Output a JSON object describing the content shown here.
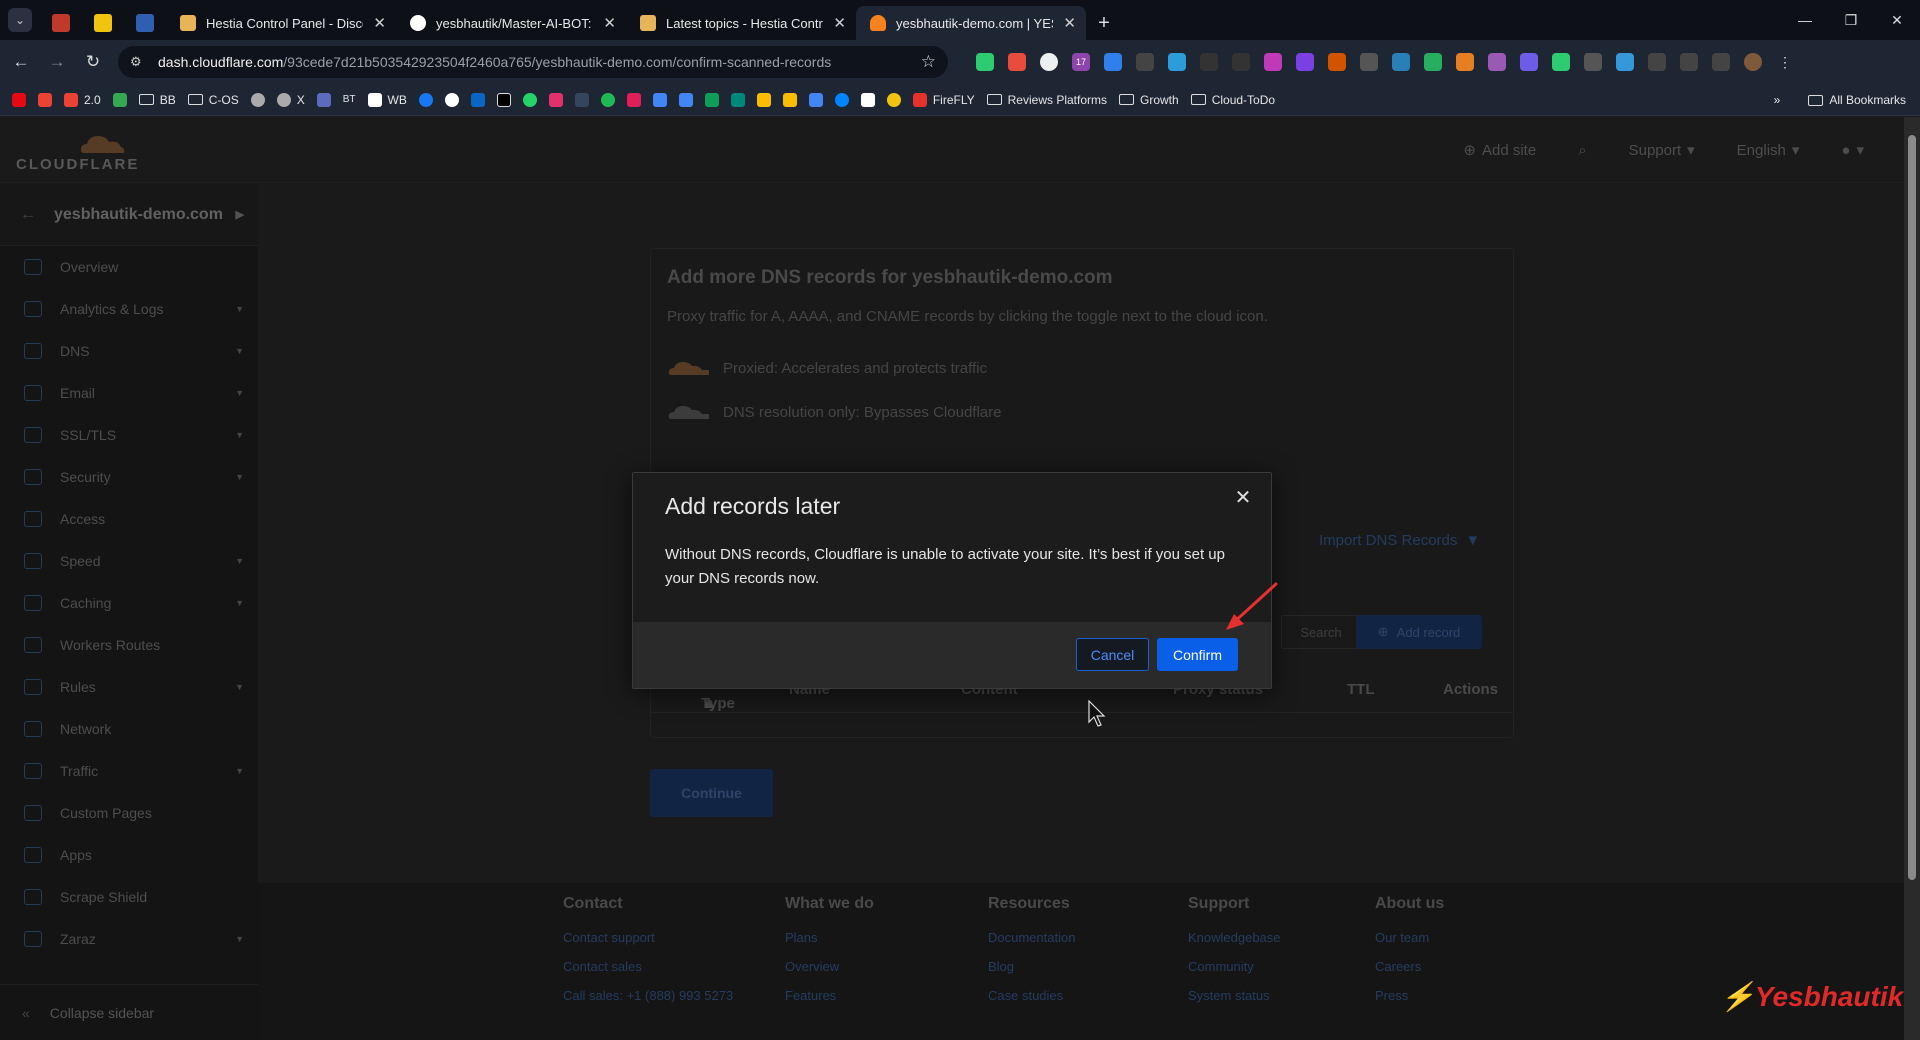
{
  "browser": {
    "tabs": [
      {
        "title": "Hestia Control Panel - Discour",
        "color": "#e8b45a"
      },
      {
        "title": "yesbhautik/Master-AI-BOT: Ma",
        "color": "#ffffff"
      },
      {
        "title": "Latest topics - Hestia Control F",
        "color": "#e8b45a"
      },
      {
        "title": "yesbhautik-demo.com | YESBH",
        "color": "#f6821f"
      }
    ],
    "url_host": "dash.cloudflare.com",
    "url_path": "/93cede7d21b503542923504f2460a765/yesbhautik-demo.com/confirm-scanned-records",
    "bookmarks": [
      "2.0",
      "BB",
      "C-OS",
      "X",
      "BT",
      "WB",
      "FireFLY",
      "Reviews Platforms",
      "Growth",
      "Cloud-ToDo"
    ],
    "all_bookmarks": "All Bookmarks",
    "ext_badge": "17"
  },
  "header": {
    "logo_text": "CLOUDFLARE",
    "add_site": "Add site",
    "support": "Support",
    "language": "English"
  },
  "sidebar": {
    "site": "yesbhautik-demo.com",
    "items": [
      {
        "label": "Overview",
        "dropdown": false
      },
      {
        "label": "Analytics & Logs",
        "dropdown": true
      },
      {
        "label": "DNS",
        "dropdown": true
      },
      {
        "label": "Email",
        "dropdown": true
      },
      {
        "label": "SSL/TLS",
        "dropdown": true
      },
      {
        "label": "Security",
        "dropdown": true
      },
      {
        "label": "Access",
        "dropdown": false
      },
      {
        "label": "Speed",
        "dropdown": true
      },
      {
        "label": "Caching",
        "dropdown": true
      },
      {
        "label": "Workers Routes",
        "dropdown": false
      },
      {
        "label": "Rules",
        "dropdown": true
      },
      {
        "label": "Network",
        "dropdown": false
      },
      {
        "label": "Traffic",
        "dropdown": true
      },
      {
        "label": "Custom Pages",
        "dropdown": false
      },
      {
        "label": "Apps",
        "dropdown": false
      },
      {
        "label": "Scrape Shield",
        "dropdown": false
      },
      {
        "label": "Zaraz",
        "dropdown": true
      }
    ],
    "collapse": "Collapse sidebar"
  },
  "main": {
    "title": "Add more DNS records for yesbhautik-demo.com",
    "description": "Proxy traffic for A, AAAA, and CNAME records by clicking the toggle next to the cloud icon.",
    "proxied": "Proxied: Accelerates and protects traffic",
    "dns_only": "DNS resolution only: Bypasses Cloudflare",
    "import": "Import DNS Records",
    "search": "Search",
    "add_record": "Add record",
    "columns": [
      "Type",
      "Name",
      "Content",
      "Proxy status",
      "TTL",
      "Actions"
    ],
    "continue": "Continue"
  },
  "footer": {
    "columns": [
      {
        "heading": "Contact",
        "links": [
          "Contact support",
          "Contact sales",
          "Call sales: +1 (888) 993 5273"
        ]
      },
      {
        "heading": "What we do",
        "links": [
          "Plans",
          "Overview",
          "Features"
        ]
      },
      {
        "heading": "Resources",
        "links": [
          "Documentation",
          "Blog",
          "Case studies"
        ]
      },
      {
        "heading": "Support",
        "links": [
          "Knowledgebase",
          "Community",
          "System status"
        ]
      },
      {
        "heading": "About us",
        "links": [
          "Our team",
          "Careers",
          "Press"
        ]
      }
    ]
  },
  "modal": {
    "title": "Add records later",
    "body": "Without DNS records, Cloudflare is unable to activate your site. It’s best if you set up your DNS records now.",
    "cancel": "Cancel",
    "confirm": "Confirm"
  },
  "watermark": "⚡Yesbhautik",
  "colors": {
    "accent": "#0a5fe8",
    "cloudflare_orange": "#f6821f",
    "annotation_arrow": "#e53030"
  }
}
